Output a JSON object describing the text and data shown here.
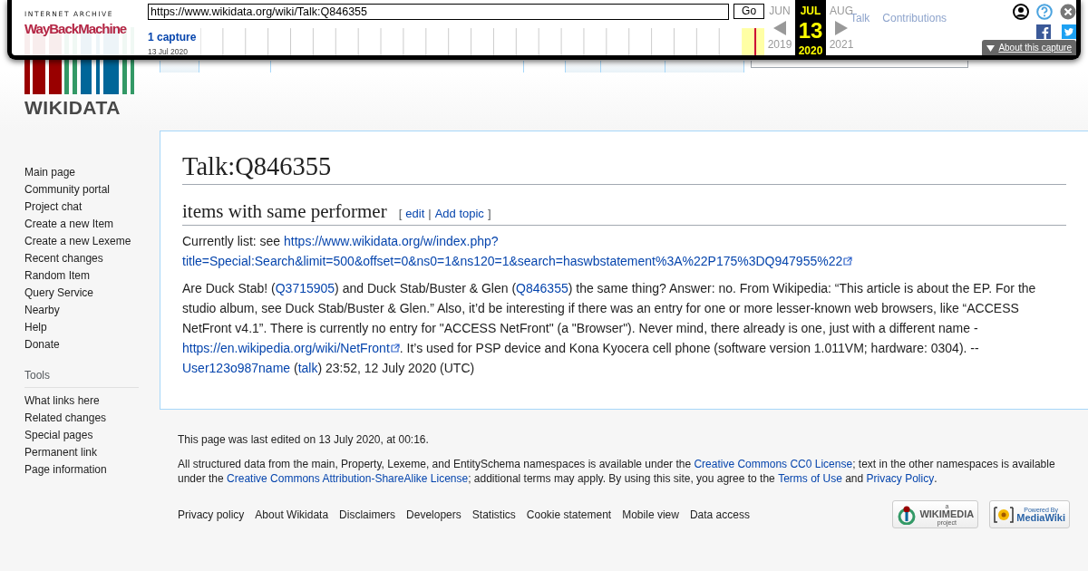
{
  "wayback": {
    "brand_top": "INTERNET ARCHIVE",
    "brand_main": "WayBackMachine",
    "url": "https://www.wikidata.org/wiki/Talk:Q846355",
    "go": "Go",
    "captures": "1 capture",
    "capture_date": "13 Jul 2020",
    "months": [
      {
        "month": "JUN",
        "year": "2019",
        "selected": false
      },
      {
        "month": "JUL",
        "day": "13",
        "year": "2020",
        "selected": true
      },
      {
        "month": "AUG",
        "year": "2021",
        "selected": false
      }
    ],
    "about": "About this capture"
  },
  "personal_links": [
    "Talk",
    "Contributions"
  ],
  "logo": {
    "wordmark": "WIKIDATA"
  },
  "tabs_left": [
    {
      "selected": false
    },
    {
      "selected": true
    }
  ],
  "tabs_right": [
    {
      "selected": true
    },
    {
      "selected": false
    },
    {
      "selected": false
    },
    {
      "selected": false
    }
  ],
  "sidebar": {
    "navigation": [
      "Main page",
      "Community portal",
      "Project chat",
      "Create a new Item",
      "Create a new Lexeme",
      "Recent changes",
      "Random Item",
      "Query Service",
      "Nearby",
      "Help",
      "Donate"
    ],
    "tools": {
      "heading": "Tools",
      "items": [
        "What links here",
        "Related changes",
        "Special pages",
        "Permanent link",
        "Page information"
      ]
    }
  },
  "page": {
    "title": "Talk:Q846355",
    "sections": [
      {
        "heading": "items with same performer",
        "edit_section": [
          {
            "kind": "text",
            "text": "["
          },
          {
            "kind": "link",
            "text": "edit"
          },
          {
            "kind": "text",
            "text": "|"
          },
          {
            "kind": "link",
            "text": "Add topic"
          },
          {
            "kind": "text",
            "text": "]"
          }
        ],
        "paragraphs": [
          [
            {
              "kind": "text",
              "text": "Currently list: see "
            },
            {
              "kind": "link",
              "text": "https://www.wikidata.org/w/index.php?"
            },
            {
              "kind": "external",
              "text": "title=Special:Search&limit=500&offset=0&ns0=1&ns120=1&search=haswbstatement%3A%22P175%3DQ947955%22"
            }
          ],
          [
            {
              "kind": "text",
              "text": "Are Duck Stab! ("
            },
            {
              "kind": "link",
              "text": "Q3715905"
            },
            {
              "kind": "text",
              "text": ") and Duck Stab/Buster & Glen ("
            },
            {
              "kind": "link",
              "text": "Q846355"
            },
            {
              "kind": "text",
              "text": ") the same thing? Answer: no. From Wikipedia: “This article is about the EP. For the studio album, see Duck Stab/Buster & Glen.” Also, it’d be interesting if there was an entry for one or more lesser-known web browsers, like “ACCESS NetFront v4.1”. There is currently no entry for \"ACCESS NetFront\" (a \"Browser\"). Never mind, there already is one, just with a different name - "
            },
            {
              "kind": "external",
              "text": "https://en.wikipedia.org/wiki/NetFront"
            },
            {
              "kind": "text",
              "text": ". It’s used for PSP device and Kona Kyocera cell phone (software version 1.011VM; hardware: 0304). -- "
            },
            {
              "kind": "link",
              "text": "User123o987name"
            },
            {
              "kind": "text",
              "text": " ("
            },
            {
              "kind": "link",
              "text": "talk"
            },
            {
              "kind": "text",
              "text": ") 23:52, 12 July 2020 (UTC)"
            }
          ]
        ]
      }
    ]
  },
  "footer": {
    "last_edited": "This page was last edited on 13 July 2020, at 00:16.",
    "license": [
      {
        "kind": "text",
        "text": "All structured data from the main, Property, Lexeme, and EntitySchema namespaces is available under the "
      },
      {
        "kind": "link",
        "text": "Creative Commons CC0 License"
      },
      {
        "kind": "text",
        "text": "; text in the other namespaces is available under the "
      },
      {
        "kind": "link",
        "text": "Creative Commons Attribution-ShareAlike License"
      },
      {
        "kind": "text",
        "text": "; additional terms may apply. By using this site, you agree to the "
      },
      {
        "kind": "link",
        "text": "Terms of Use"
      },
      {
        "kind": "text",
        "text": " and "
      },
      {
        "kind": "link",
        "text": "Privacy Policy"
      },
      {
        "kind": "text",
        "text": "."
      }
    ],
    "links": [
      "Privacy policy",
      "About Wikidata",
      "Disclaimers",
      "Developers",
      "Statistics",
      "Cookie statement",
      "Mobile view",
      "Data access"
    ],
    "badges": [
      {
        "kind": "wikimedia",
        "lines": [
          "a",
          "WIKIMEDIA",
          "project"
        ]
      },
      {
        "kind": "mediawiki",
        "lines": [
          "Powered By",
          "MediaWiki"
        ]
      }
    ]
  }
}
